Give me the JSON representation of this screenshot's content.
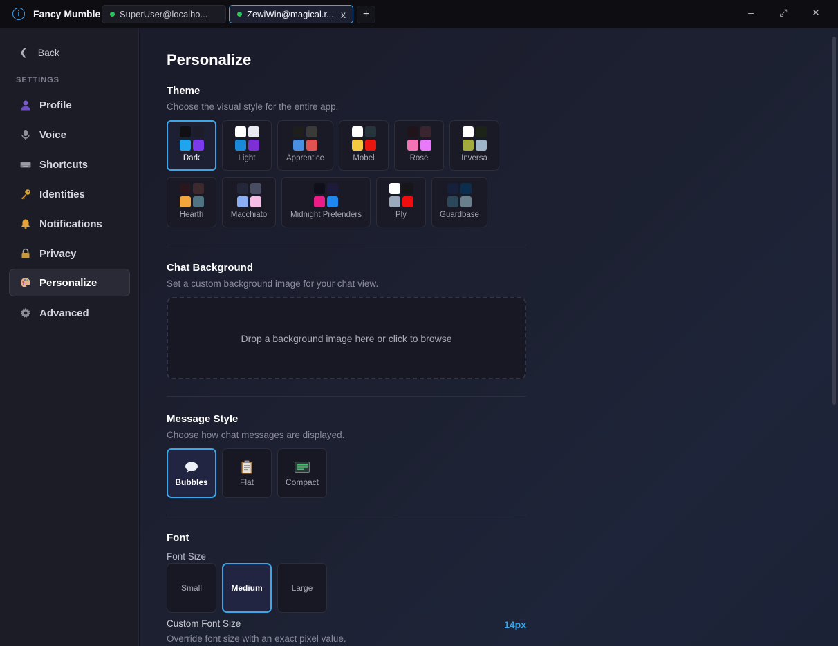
{
  "titlebar": {
    "app_title": "Fancy Mumble",
    "tabs": [
      {
        "label": "SuperUser@localho...",
        "status": "connected"
      },
      {
        "label": "ZewiWin@magical.r...",
        "status": "connected",
        "close": "x"
      }
    ],
    "add_tab": "+",
    "minimize": "–",
    "maximize": "⤢",
    "close": "✕"
  },
  "sidebar": {
    "back_label": "Back",
    "heading": "SETTINGS",
    "items": [
      {
        "label": "Profile",
        "icon": "person-icon"
      },
      {
        "label": "Voice",
        "icon": "microphone-icon"
      },
      {
        "label": "Shortcuts",
        "icon": "keyboard-icon"
      },
      {
        "label": "Identities",
        "icon": "key-icon"
      },
      {
        "label": "Notifications",
        "icon": "bell-icon"
      },
      {
        "label": "Privacy",
        "icon": "lock-icon"
      },
      {
        "label": "Personalize",
        "icon": "palette-icon",
        "active": true
      },
      {
        "label": "Advanced",
        "icon": "gear-icon"
      }
    ]
  },
  "main": {
    "title": "Personalize",
    "theme": {
      "title": "Theme",
      "description": "Choose the visual style for the entire app.",
      "selected": "Dark",
      "options": [
        {
          "label": "Dark",
          "colors": [
            "#0f0f14",
            "#1c1c2b",
            "#1fa4ee",
            "#7c3aed"
          ]
        },
        {
          "label": "Light",
          "colors": [
            "#ffffff",
            "#e9e9f0",
            "#1a8ad8",
            "#7b2fd4"
          ]
        },
        {
          "label": "Apprentice",
          "colors": [
            "#1e1f1c",
            "#3a3a38",
            "#4a90e2",
            "#e05350"
          ]
        },
        {
          "label": "Mobel",
          "colors": [
            "#ffffff",
            "#26343b",
            "#f5c842",
            "#e8160e"
          ]
        },
        {
          "label": "Rose",
          "colors": [
            "#1f141a",
            "#3a2430",
            "#f473b5",
            "#e879f9"
          ]
        },
        {
          "label": "Inversa",
          "colors": [
            "#ffffff",
            "#1c2418",
            "#a3ab3c",
            "#9fb6c8"
          ]
        },
        {
          "label": "Hearth",
          "colors": [
            "#2a161d",
            "#3d2a2e",
            "#f4a63c",
            "#4f7381"
          ]
        },
        {
          "label": "Macchiato",
          "colors": [
            "#24273a",
            "#494d64",
            "#8aadf4",
            "#f5bde6"
          ]
        },
        {
          "label": "Midnight Pretenders",
          "colors": [
            "#0f0f1a",
            "#1e1b3a",
            "#ec1c86",
            "#1e88f0"
          ]
        },
        {
          "label": "Ply",
          "colors": [
            "#ffffff",
            "#161618",
            "#9aa9bb",
            "#ee0e0e"
          ]
        },
        {
          "label": "Guardbase",
          "colors": [
            "#16203a",
            "#0b2e4f",
            "#2b4759",
            "#6a7f8c"
          ]
        }
      ]
    },
    "chat_background": {
      "title": "Chat Background",
      "description": "Set a custom background image for your chat view.",
      "dropzone_text": "Drop a background image here or click to browse"
    },
    "message_style": {
      "title": "Message Style",
      "description": "Choose how chat messages are displayed.",
      "selected": "Bubbles",
      "options": [
        {
          "label": "Bubbles",
          "icon": "speech-bubble-icon",
          "glyph": "💬"
        },
        {
          "label": "Flat",
          "icon": "clipboard-icon",
          "glyph": "📋"
        },
        {
          "label": "Compact",
          "icon": "terminal-icon",
          "glyph": "▤"
        }
      ]
    },
    "font": {
      "title": "Font",
      "size_label": "Font Size",
      "selected": "Medium",
      "sizes": [
        "Small",
        "Medium",
        "Large"
      ],
      "custom_label": "Custom Font Size",
      "custom_value": "14px",
      "custom_description": "Override font size with an exact pixel value."
    }
  }
}
